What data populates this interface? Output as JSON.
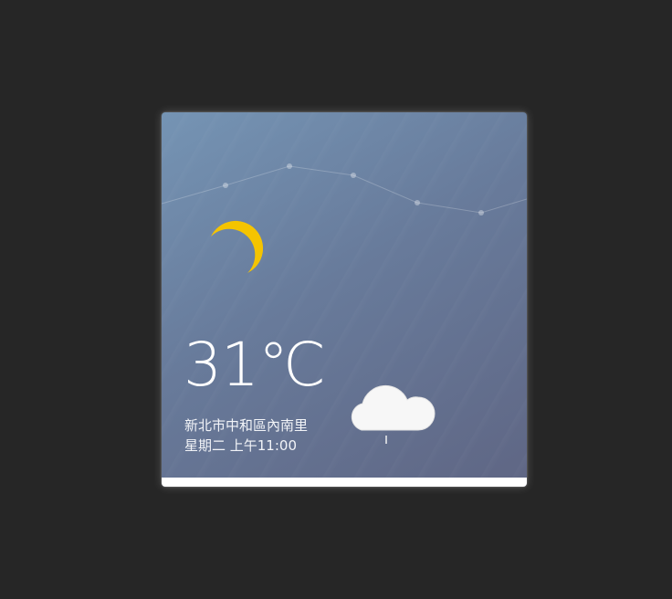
{
  "weather": {
    "temperature": "31",
    "unit": "℃",
    "location": "新北市中和區內南里",
    "datetime": "星期二 上午11:00",
    "condition_icon": "cloud-icon",
    "time_of_day_icon": "crescent-moon-icon"
  },
  "colors": {
    "moon": "#f5c400",
    "cloud": "#f7f7f7",
    "text": "#ffffff",
    "background_top": "#7594b4",
    "background_bottom": "#5f6684"
  }
}
